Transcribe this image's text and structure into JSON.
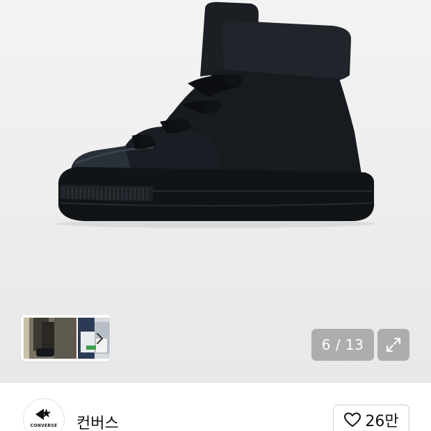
{
  "gallery": {
    "counter": "6 / 13",
    "thumbnail_count": 2
  },
  "icons": {
    "next": "chevron-right-icon",
    "expand": "expand-icon",
    "like": "heart-icon"
  },
  "brand": {
    "logo_text": "CONVERSE",
    "name": "컨버스",
    "like_count": "26만"
  }
}
